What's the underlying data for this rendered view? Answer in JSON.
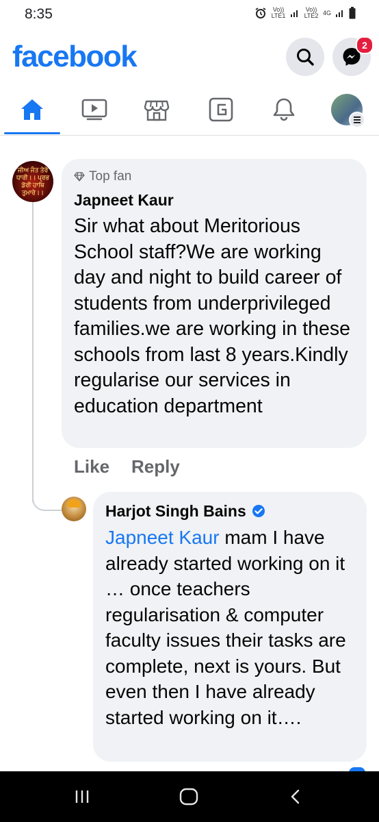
{
  "status_bar": {
    "time": "8:35",
    "sim1_label": "Vo)) LTE1",
    "sim2_label": "Vo)) LTE2",
    "network": "4G"
  },
  "header": {
    "logo": "facebook",
    "search_icon": "search-icon",
    "messenger_icon": "messenger-icon",
    "messenger_badge": "2"
  },
  "tabs": [
    {
      "name": "home",
      "icon": "home-icon",
      "active": true
    },
    {
      "name": "watch",
      "icon": "video-icon",
      "active": false
    },
    {
      "name": "marketplace",
      "icon": "store-icon",
      "active": false
    },
    {
      "name": "gaming",
      "icon": "gaming-icon",
      "active": false
    },
    {
      "name": "notifications",
      "icon": "bell-icon",
      "active": false
    },
    {
      "name": "menu",
      "icon": "profile-avatar",
      "active": false
    }
  ],
  "comment": {
    "badge": "Top fan",
    "author": "Japneet Kaur",
    "avatar_text": "ਜੀਅ ਜੰਤ ਤੇਰੇ ਧਾਰੀ।। ਪ੍ਰਭ ਡੋਰੀ ਹਾਥਿ ਤੁਮਾਰੇ।।",
    "text": "Sir what about Meritorious School staff?We are working day and night to build career of students from underprivileged families.we are working in these schools from last 8 years.Kindly regularise our services in education department",
    "like_label": "Like",
    "reply_label": "Reply"
  },
  "reply": {
    "author": "Harjot Singh Bains",
    "verified": true,
    "mention": "Japneet Kaur",
    "text": " mam I have already started working on it … once  teachers regularisation & computer faculty issues their tasks are complete, next is yours. But even then I have already started working on it…."
  },
  "colors": {
    "brand": "#1877f2",
    "bubble": "#f0f2f5",
    "secondary_text": "#65676b",
    "badge": "#e41e3f"
  }
}
